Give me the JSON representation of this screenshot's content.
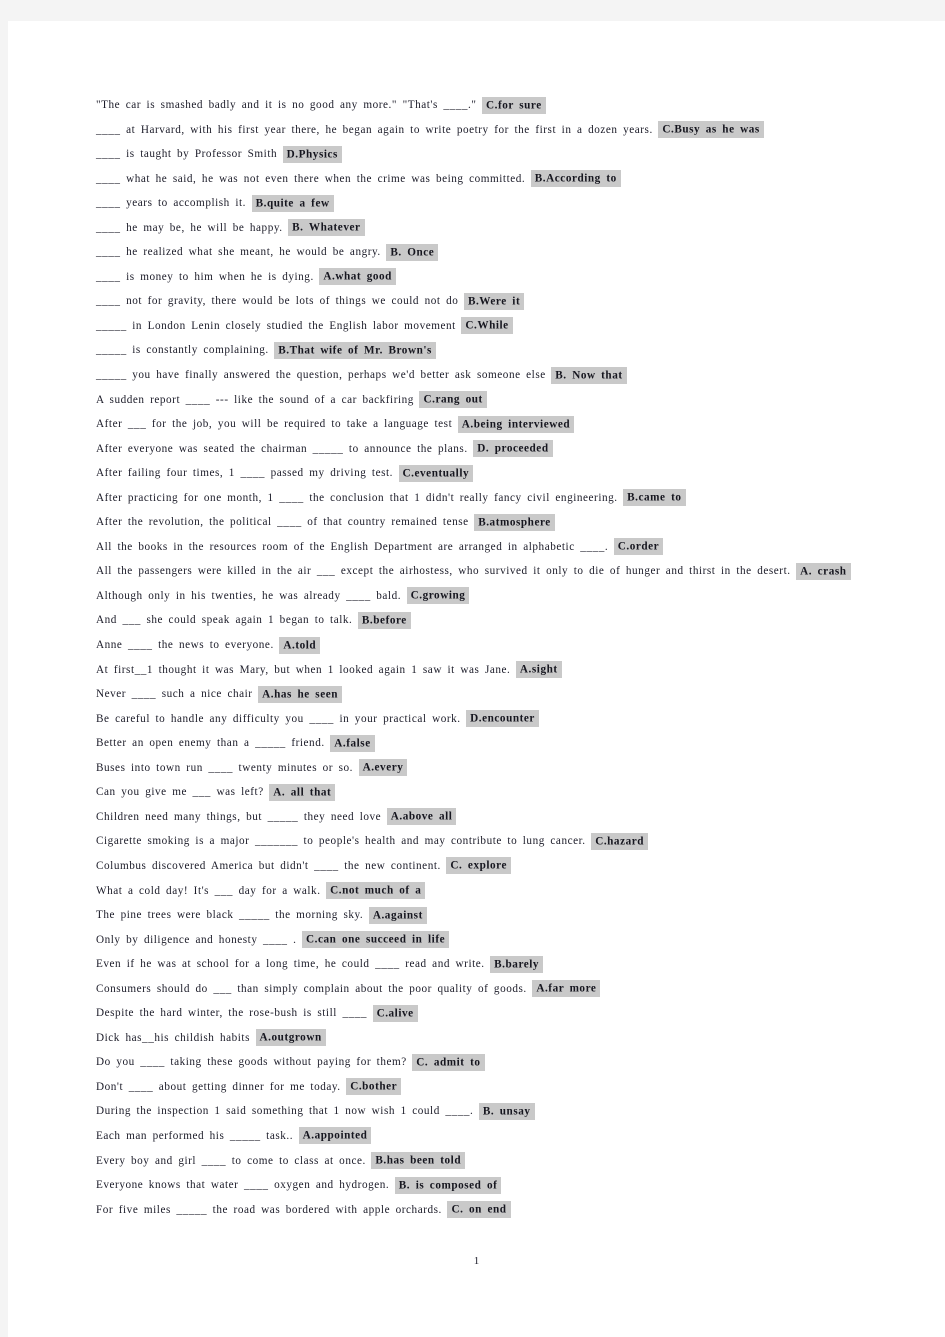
{
  "document": {
    "page_number": "1",
    "highlight_color": "#c9c9c9",
    "text_color": "#1b1b28",
    "page_background": "#ffffff",
    "canvas_background": "#f4f4f4"
  },
  "lines": [
    {
      "stem": "\"The car is smashed badly and it is no good any more.\" \"That's ____.\"",
      "answer": "C.for sure"
    },
    {
      "stem": "____ at Harvard, with his first year there, he began again to write poetry for the first in a dozen years.",
      "answer": "C.Busy as he was"
    },
    {
      "stem": "____ is taught by Professor Smith",
      "answer": "D.Physics"
    },
    {
      "stem": "____ what he said, he was not even there when the crime was being committed.",
      "answer": "B.According to"
    },
    {
      "stem": "____ years to accomplish it.",
      "answer": "B.quite a few"
    },
    {
      "stem": "____ he may be, he will be happy.",
      "answer": "B. Whatever"
    },
    {
      "stem": "____ he realized what she meant, he would be angry.",
      "answer": "B. Once"
    },
    {
      "stem": "____ is money to him when he is dying.",
      "answer": "A.what good"
    },
    {
      "stem": "____ not for gravity, there would be lots of things we could not do",
      "answer": "B.Were it"
    },
    {
      "stem": "_____ in London Lenin closely studied the English labor movement",
      "answer": "C.While"
    },
    {
      "stem": "_____ is constantly complaining.",
      "answer": "B.That wife of Mr. Brown's"
    },
    {
      "stem": "_____ you have finally answered the question, perhaps we'd better ask someone else",
      "answer": "B. Now that"
    },
    {
      "stem": "A sudden report ____ --- like the sound of a car backfiring",
      "answer": "C.rang out"
    },
    {
      "stem": "After ___ for the job, you will be required to take a language test",
      "answer": "A.being interviewed"
    },
    {
      "stem": "After everyone was seated the chairman _____ to announce the plans.",
      "answer": "D. proceeded"
    },
    {
      "stem": "After failing four times, 1 ____ passed my driving test.",
      "answer": "C.eventually"
    },
    {
      "stem": "After practicing for one month, 1 ____ the conclusion that 1 didn't really fancy civil engineering.",
      "answer": "B.came to"
    },
    {
      "stem": "After the revolution, the political ____ of that country remained tense",
      "answer": "B.atmosphere"
    },
    {
      "stem": "All the books in the resources room of the English Department are arranged in alphabetic ____.",
      "answer": "C.order"
    },
    {
      "stem": "All the passengers were killed in the air ___ except the airhostess, who survived it only to die of hunger and thirst in the desert.",
      "answer": "A. crash"
    },
    {
      "stem": "Although only in his twenties, he was already ____ bald.",
      "answer": "C.growing"
    },
    {
      "stem": "And ___ she could speak again 1 began to talk.",
      "answer": "B.before"
    },
    {
      "stem": "Anne ____ the news to everyone.",
      "answer": "A.told"
    },
    {
      "stem": "At first__1 thought it was Mary, but when 1 looked again 1 saw it was Jane.",
      "answer": "A.sight"
    },
    {
      "stem": "Never ____ such a nice chair",
      "answer": "A.has he seen"
    },
    {
      "stem": "Be careful to handle any difficulty you ____ in your practical work.",
      "answer": "D.encounter"
    },
    {
      "stem": "Better an open enemy than a _____ friend.",
      "answer": "A.false"
    },
    {
      "stem": "Buses into town run ____ twenty minutes or so.",
      "answer": "A.every"
    },
    {
      "stem": "Can you give me ___ was left?",
      "answer": "A. all that"
    },
    {
      "stem": "Children need many things, but _____ they need love",
      "answer": "A.above all"
    },
    {
      "stem": "Cigarette smoking is a major _______ to people's health and may contribute to lung cancer.",
      "answer": "C.hazard"
    },
    {
      "stem": "Columbus discovered America but didn't ____ the new continent.",
      "answer": "C. explore"
    },
    {
      "stem": "What a cold day! It's ___ day for a walk.",
      "answer": "C.not much of a"
    },
    {
      "stem": "The pine trees were black _____ the morning sky.",
      "answer": "A.against"
    },
    {
      "stem": "Only by diligence and honesty ____ .",
      "answer": "C.can one succeed in life"
    },
    {
      "stem": "Even if he was at school for a long time, he could ____ read and write.",
      "answer": "B.barely"
    },
    {
      "stem": "Consumers should do ___ than simply complain about the poor quality of goods.",
      "answer": "A.far more"
    },
    {
      "stem": "Despite the hard winter, the rose-bush is still ____",
      "answer": "C.alive"
    },
    {
      "stem": "Dick has__his childish habits",
      "answer": "A.outgrown"
    },
    {
      "stem": "Do you ____ taking these goods without paying for them?",
      "answer": "C. admit to"
    },
    {
      "stem": "Don't ____ about getting dinner for me today.",
      "answer": "C.bother"
    },
    {
      "stem": "During the inspection 1 said something that 1 now wish 1 could ____.",
      "answer": "B. unsay"
    },
    {
      "stem": "Each man performed his _____ task..",
      "answer": "A.appointed"
    },
    {
      "stem": "Every boy and girl ____ to come to class at once.",
      "answer": "B.has been told"
    },
    {
      "stem": "Everyone knows that water ____ oxygen and hydrogen.",
      "answer": "B. is composed of"
    },
    {
      "stem": "For five miles _____ the road was bordered with apple orchards.",
      "answer": "C. on end"
    }
  ]
}
